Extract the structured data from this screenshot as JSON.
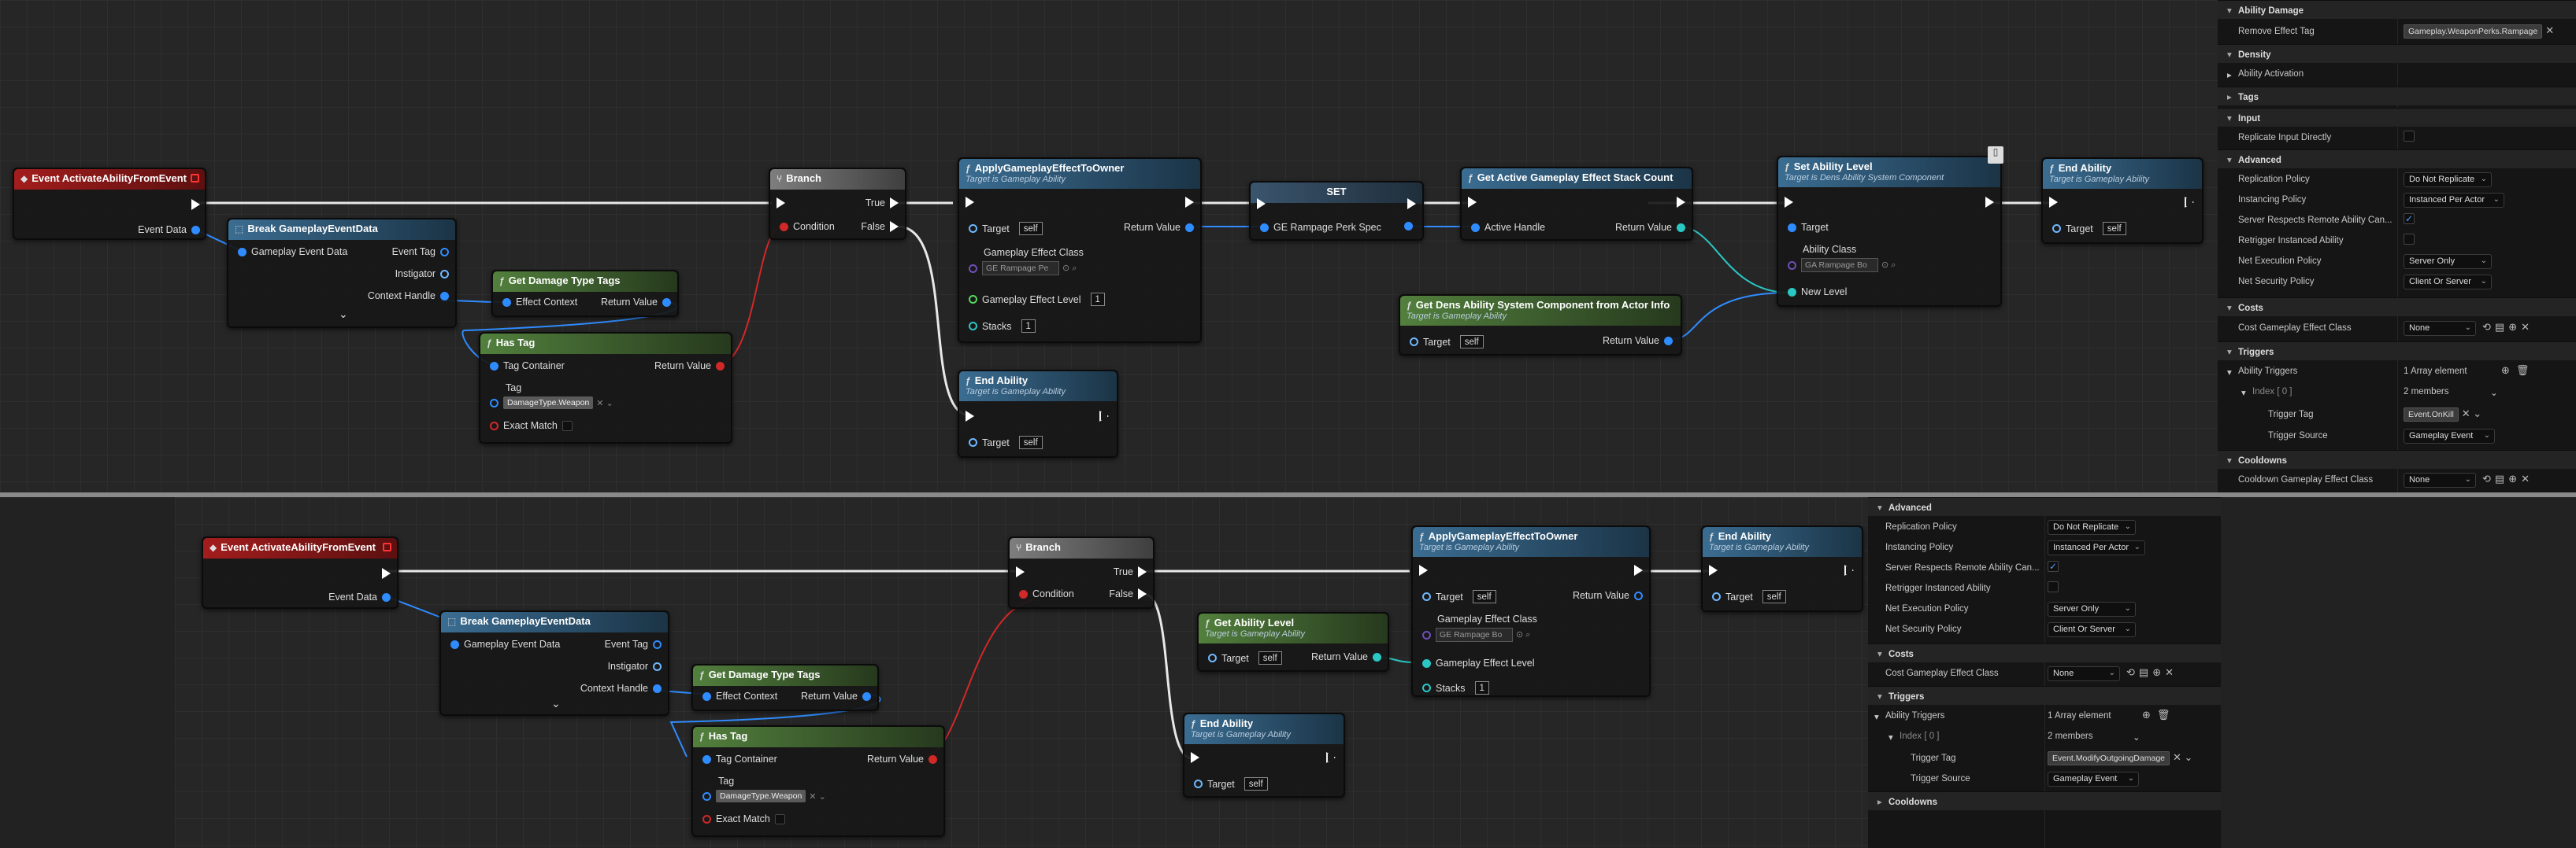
{
  "top": {
    "event_activate": {
      "title": "Event ActivateAbilityFromEvent",
      "event_data": "Event Data"
    },
    "break_event": {
      "title": "Break GameplayEventData",
      "gameplay_event_data": "Gameplay Event Data",
      "event_tag": "Event Tag",
      "instigator": "Instigator",
      "context_handle": "Context Handle",
      "expand": "⌄"
    },
    "get_damage_tags": {
      "title": "Get Damage Type Tags",
      "effect_context": "Effect Context",
      "return_value": "Return Value"
    },
    "has_tag": {
      "title": "Has Tag",
      "tag_container": "Tag Container",
      "return_value": "Return Value",
      "tag": "Tag",
      "tag_value": "DamageType.Weapon",
      "exact_match": "Exact Match"
    },
    "branch": {
      "title": "Branch",
      "condition": "Condition",
      "true": "True",
      "false": "False"
    },
    "apply_ge": {
      "title": "ApplyGameplayEffectToOwner",
      "subtitle": "Target is Gameplay Ability",
      "target": "Target",
      "self": "self",
      "return_value": "Return Value",
      "ge_class": "Gameplay Effect Class",
      "ge_class_value": "GE Rampage Pe",
      "ge_level": "Gameplay Effect Level",
      "ge_level_value": "1",
      "stacks": "Stacks",
      "stacks_value": "1"
    },
    "set_node": {
      "title": "SET",
      "var": "GE Rampage Perk Spec"
    },
    "get_active_stack": {
      "title": "Get Active Gameplay Effect Stack Count",
      "active_handle": "Active Handle",
      "return_value": "Return Value"
    },
    "set_ability_level": {
      "title": "Set Ability Level",
      "subtitle": "Target is Dens Ability System Component",
      "target": "Target",
      "ability_class": "Ability Class",
      "ability_class_value": "GA Rampage Bo",
      "new_level": "New Level"
    },
    "get_dens_asc": {
      "title": "Get Dens Ability System Component from Actor Info",
      "subtitle": "Target is Gameplay Ability",
      "target": "Target",
      "self": "self",
      "return_value": "Return Value"
    },
    "end_ability_right": {
      "title": "End Ability",
      "subtitle": "Target is Gameplay Ability",
      "target": "Target",
      "self": "self"
    },
    "end_ability_mid": {
      "title": "End Ability",
      "subtitle": "Target is Gameplay Ability",
      "target": "Target",
      "self": "self"
    }
  },
  "bottom": {
    "event_activate": {
      "title": "Event ActivateAbilityFromEvent",
      "event_data": "Event Data"
    },
    "break_event": {
      "title": "Break GameplayEventData",
      "gameplay_event_data": "Gameplay Event Data",
      "event_tag": "Event Tag",
      "instigator": "Instigator",
      "context_handle": "Context Handle",
      "expand": "⌄"
    },
    "get_damage_tags": {
      "title": "Get Damage Type Tags",
      "effect_context": "Effect Context",
      "return_value": "Return Value"
    },
    "has_tag": {
      "title": "Has Tag",
      "tag_container": "Tag Container",
      "return_value": "Return Value",
      "tag": "Tag",
      "tag_value": "DamageType.Weapon",
      "exact_match": "Exact Match"
    },
    "branch": {
      "title": "Branch",
      "condition": "Condition",
      "true": "True",
      "false": "False"
    },
    "get_ability_level": {
      "title": "Get Ability Level",
      "subtitle": "Target is Gameplay Ability",
      "target": "Target",
      "self": "self",
      "return_value": "Return Value"
    },
    "apply_ge": {
      "title": "ApplyGameplayEffectToOwner",
      "subtitle": "Target is Gameplay Ability",
      "target": "Target",
      "self": "self",
      "return_value": "Return Value",
      "ge_class": "Gameplay Effect Class",
      "ge_class_value": "GE Rampage Bo",
      "ge_level": "Gameplay Effect Level",
      "stacks": "Stacks",
      "stacks_value": "1"
    },
    "end_ability_right": {
      "title": "End Ability",
      "subtitle": "Target is Gameplay Ability",
      "target": "Target",
      "self": "self"
    },
    "end_ability_mid": {
      "title": "End Ability",
      "subtitle": "Target is Gameplay Ability",
      "target": "Target",
      "self": "self"
    }
  },
  "panel_top": {
    "ability_damage": "Ability Damage",
    "remove_effect_tag": "Remove Effect Tag",
    "remove_effect_tag_value": "Gameplay.WeaponPerks.Rampage",
    "density": "Density",
    "ability_activation": "Ability Activation",
    "tags": "Tags",
    "input": "Input",
    "replicate_input": "Replicate Input Directly",
    "advanced": "Advanced",
    "replication_policy": "Replication Policy",
    "replication_policy_value": "Do Not Replicate",
    "instancing_policy": "Instancing Policy",
    "instancing_policy_value": "Instanced Per Actor",
    "server_respects": "Server Respects Remote Ability Can...",
    "retrigger": "Retrigger Instanced Ability",
    "net_execution": "Net Execution Policy",
    "net_execution_value": "Server Only",
    "net_security": "Net Security Policy",
    "net_security_value": "Client Or Server",
    "costs": "Costs",
    "cost_ge_class": "Cost Gameplay Effect Class",
    "cost_ge_value": "None",
    "triggers": "Triggers",
    "ability_triggers": "Ability Triggers",
    "ability_triggers_value": "1 Array element",
    "index0": "Index [ 0 ]",
    "index0_value": "2 members",
    "trigger_tag": "Trigger Tag",
    "trigger_tag_value": "Event.OnKill",
    "trigger_source": "Trigger Source",
    "trigger_source_value": "Gameplay Event",
    "cooldowns": "Cooldowns",
    "cooldown_ge_class": "Cooldown Gameplay Effect Class",
    "cooldown_ge_value": "None"
  },
  "panel_bottom": {
    "advanced": "Advanced",
    "replication_policy": "Replication Policy",
    "replication_policy_value": "Do Not Replicate",
    "instancing_policy": "Instancing Policy",
    "instancing_policy_value": "Instanced Per Actor",
    "server_respects": "Server Respects Remote Ability Can...",
    "retrigger": "Retrigger Instanced Ability",
    "net_execution": "Net Execution Policy",
    "net_execution_value": "Server Only",
    "net_security": "Net Security Policy",
    "net_security_value": "Client Or Server",
    "costs": "Costs",
    "cost_ge_class": "Cost Gameplay Effect Class",
    "cost_ge_value": "None",
    "triggers": "Triggers",
    "ability_triggers": "Ability Triggers",
    "ability_triggers_value": "1 Array element",
    "index0": "Index [ 0 ]",
    "index0_value": "2 members",
    "trigger_tag": "Trigger Tag",
    "trigger_tag_value": "Event.ModifyOutgoingDamage",
    "trigger_source": "Trigger Source",
    "trigger_source_value": "Gameplay Event",
    "cooldowns": "Cooldowns"
  }
}
